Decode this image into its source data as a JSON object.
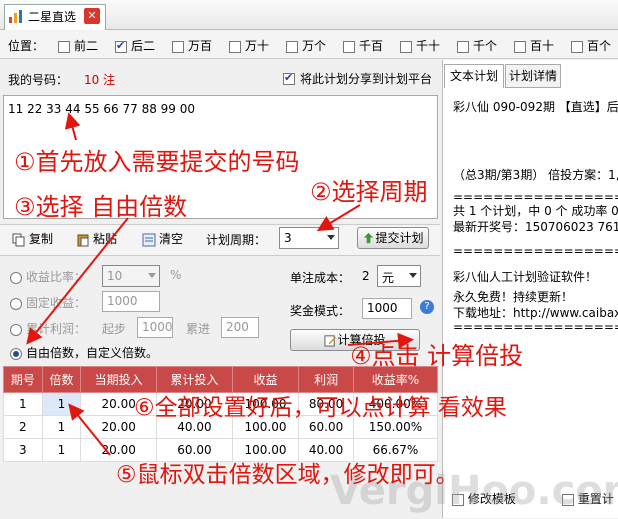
{
  "window": {
    "tab_title": "二星直选",
    "close_glyph": "✕"
  },
  "position_bar": {
    "label": "位置：",
    "options": [
      {
        "label": "前二",
        "checked": false
      },
      {
        "label": "后二",
        "checked": true
      },
      {
        "label": "万百",
        "checked": false
      },
      {
        "label": "万十",
        "checked": false
      },
      {
        "label": "万个",
        "checked": false
      },
      {
        "label": "千百",
        "checked": false
      },
      {
        "label": "千十",
        "checked": false
      },
      {
        "label": "千个",
        "checked": false
      },
      {
        "label": "百十",
        "checked": false
      },
      {
        "label": "百个",
        "checked": false
      }
    ]
  },
  "my_numbers": {
    "label": "我的号码：",
    "count": "10 注",
    "share_label": "将此计划分享到计划平台",
    "share_checked": true,
    "content": "11 22 33 44 55 66 77 88 99 00"
  },
  "toolbar": {
    "copy": "复制",
    "paste": "粘贴",
    "clear": "清空",
    "period_label": "计划周期：",
    "period_value": "3",
    "submit": "提交计划"
  },
  "options": {
    "ratio_label": "收益比率：",
    "ratio_value": "10",
    "ratio_unit": "%",
    "fixed_label": "固定收益：",
    "fixed_value": "1000",
    "cumulative_label": "累计利润：",
    "start_label": "起步",
    "start_value": "1000",
    "step_label": "累进",
    "step_value": "200",
    "free_label": "自由倍数，自定义倍数。",
    "unit_cost_label": "单注成本：",
    "unit_cost_value": "2",
    "unit_cost_unit": "元",
    "bonus_label": "奖金模式：",
    "bonus_value": "1000",
    "calc_button": "计算倍投"
  },
  "table": {
    "headers": [
      "期号",
      "倍数",
      "当期投入",
      "累计投入",
      "收益",
      "利润",
      "收益率%"
    ],
    "rows": [
      [
        "1",
        "1",
        "20.00",
        "20.00",
        "100.00",
        "80.00",
        "400.00%"
      ],
      [
        "2",
        "1",
        "20.00",
        "40.00",
        "100.00",
        "60.00",
        "150.00%"
      ],
      [
        "3",
        "1",
        "20.00",
        "60.00",
        "100.00",
        "40.00",
        "66.67%"
      ]
    ]
  },
  "right_panel": {
    "tabs": [
      "文本计划",
      "计划详情"
    ],
    "lines": [
      "彩八仙 090-092期 【直选】后二",
      "（总3期/第3期） 倍投方案：1,",
      "===================",
      "共 1 个计划，中 0 个 成功率 0",
      "最新开奖号：150706023 7616",
      "===================",
      "彩八仙人工计划验证软件！",
      "永久免费！持续更新！",
      "下载地址：http://www.caibaxi",
      "==================="
    ],
    "edit_template": "修改模板",
    "reset": "重置计"
  },
  "annotations": {
    "a1": "①首先放入需要提交的号码",
    "a2": "②选择周期",
    "a3": "③选择 自由倍数",
    "a4": "④点击 计算倍投",
    "a5": "⑥全部设置好后，可以点计算 看效果",
    "a6": "⑤鼠标双击倍数区域，修改即可。"
  },
  "watermark": "VergiHoo.com",
  "colors": {
    "accent_red": "#e0160f",
    "header_red": "#c94848"
  }
}
